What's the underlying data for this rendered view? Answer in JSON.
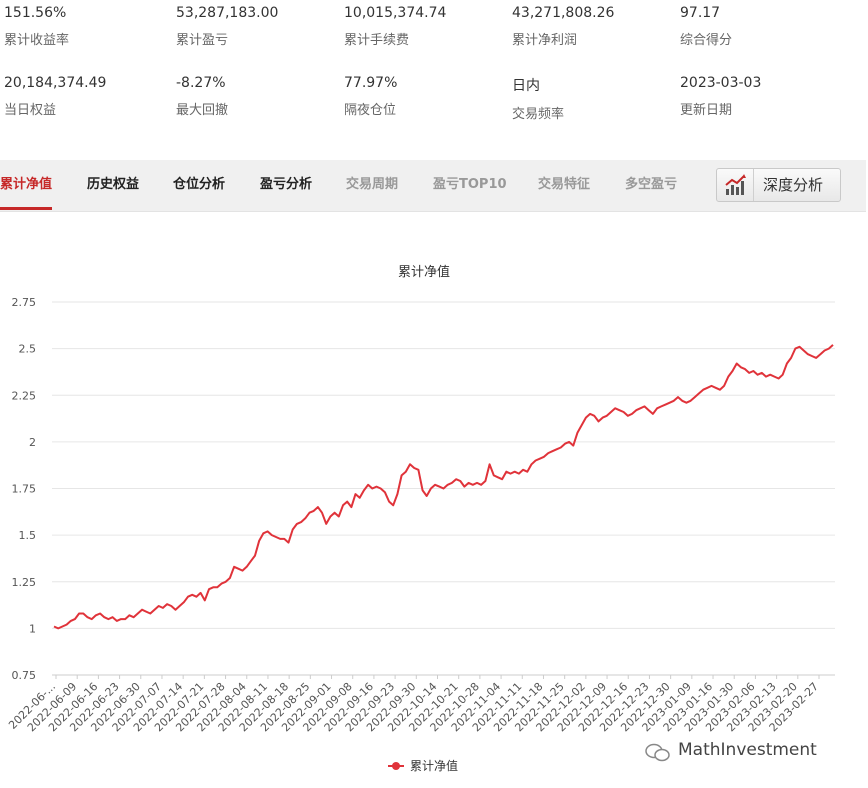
{
  "stats": [
    {
      "value": "151.56%",
      "label": "累计收益率"
    },
    {
      "value": "53,287,183.00",
      "label": "累计盈亏"
    },
    {
      "value": "10,015,374.74",
      "label": "累计手续费"
    },
    {
      "value": "43,271,808.26",
      "label": "累计净利润"
    },
    {
      "value": "97.17",
      "label": "综合得分"
    },
    {
      "value": "20,184,374.49",
      "label": "当日权益"
    },
    {
      "value": "-8.27%",
      "label": "最大回撤"
    },
    {
      "value": "77.97%",
      "label": "隔夜仓位"
    },
    {
      "value": "日内",
      "label": "交易频率"
    },
    {
      "value": "2023-03-03",
      "label": "更新日期"
    }
  ],
  "tabs": [
    {
      "label": "累计净值",
      "state": "active"
    },
    {
      "label": "历史权益",
      "state": "normal"
    },
    {
      "label": "仓位分析",
      "state": "normal"
    },
    {
      "label": "盈亏分析",
      "state": "normal"
    },
    {
      "label": "交易周期",
      "state": "dim"
    },
    {
      "label": "盈亏TOP10",
      "state": "dim"
    },
    {
      "label": "交易特征",
      "state": "dim"
    },
    {
      "label": "多空盈亏",
      "state": "dim"
    }
  ],
  "deep_button": {
    "label": "深度分析",
    "icon": "trend-chart-icon"
  },
  "watermark": {
    "text": "MathInvestment",
    "icon": "wechat-icon"
  },
  "colors": {
    "accent": "#c62828",
    "line": "#e0333a"
  },
  "chart_data": {
    "type": "line",
    "title": "累计净值",
    "ylim": [
      0.75,
      2.75
    ],
    "yticks": [
      "0.75",
      "1",
      "1.25",
      "1.5",
      "1.75",
      "2",
      "2.25",
      "2.5",
      "2.75"
    ],
    "xticks": [
      "2022-06-...",
      "2022-06-09",
      "2022-06-16",
      "2022-06-23",
      "2022-06-30",
      "2022-07-07",
      "2022-07-14",
      "2022-07-21",
      "2022-07-28",
      "2022-08-04",
      "2022-08-11",
      "2022-08-18",
      "2022-08-25",
      "2022-09-01",
      "2022-09-08",
      "2022-09-16",
      "2022-09-23",
      "2022-09-30",
      "2022-10-14",
      "2022-10-21",
      "2022-10-28",
      "2022-11-04",
      "2022-11-11",
      "2022-11-18",
      "2022-11-25",
      "2022-12-02",
      "2022-12-09",
      "2022-12-16",
      "2022-12-23",
      "2022-12-30",
      "2023-01-09",
      "2023-01-16",
      "2023-01-30",
      "2023-02-06",
      "2023-02-13",
      "2023-02-20",
      "2023-02-27"
    ],
    "grid": true,
    "legend_position": "bottom",
    "series": [
      {
        "name": "累计净值",
        "values": [
          1.01,
          1.0,
          1.01,
          1.02,
          1.04,
          1.05,
          1.08,
          1.08,
          1.06,
          1.05,
          1.07,
          1.08,
          1.06,
          1.05,
          1.06,
          1.04,
          1.05,
          1.05,
          1.07,
          1.06,
          1.08,
          1.1,
          1.09,
          1.08,
          1.1,
          1.12,
          1.11,
          1.13,
          1.12,
          1.1,
          1.12,
          1.14,
          1.17,
          1.18,
          1.17,
          1.19,
          1.15,
          1.21,
          1.22,
          1.22,
          1.24,
          1.25,
          1.27,
          1.33,
          1.32,
          1.31,
          1.33,
          1.36,
          1.39,
          1.47,
          1.51,
          1.52,
          1.5,
          1.49,
          1.48,
          1.48,
          1.46,
          1.53,
          1.56,
          1.57,
          1.59,
          1.62,
          1.63,
          1.65,
          1.62,
          1.56,
          1.6,
          1.62,
          1.6,
          1.66,
          1.68,
          1.65,
          1.72,
          1.7,
          1.74,
          1.77,
          1.75,
          1.76,
          1.75,
          1.73,
          1.68,
          1.66,
          1.72,
          1.82,
          1.84,
          1.88,
          1.86,
          1.85,
          1.74,
          1.71,
          1.75,
          1.77,
          1.76,
          1.75,
          1.77,
          1.78,
          1.8,
          1.79,
          1.76,
          1.78,
          1.77,
          1.78,
          1.77,
          1.79,
          1.88,
          1.82,
          1.81,
          1.8,
          1.84,
          1.83,
          1.84,
          1.83,
          1.85,
          1.84,
          1.88,
          1.9,
          1.91,
          1.92,
          1.94,
          1.95,
          1.96,
          1.97,
          1.99,
          2.0,
          1.98,
          2.05,
          2.09,
          2.13,
          2.15,
          2.14,
          2.11,
          2.13,
          2.14,
          2.16,
          2.18,
          2.17,
          2.16,
          2.14,
          2.15,
          2.17,
          2.18,
          2.19,
          2.17,
          2.15,
          2.18,
          2.19,
          2.2,
          2.21,
          2.22,
          2.24,
          2.22,
          2.21,
          2.22,
          2.24,
          2.26,
          2.28,
          2.29,
          2.3,
          2.29,
          2.28,
          2.3,
          2.35,
          2.38,
          2.42,
          2.4,
          2.39,
          2.37,
          2.38,
          2.36,
          2.37,
          2.35,
          2.36,
          2.35,
          2.34,
          2.36,
          2.42,
          2.45,
          2.5,
          2.51,
          2.49,
          2.47,
          2.46,
          2.45,
          2.47,
          2.49,
          2.5,
          2.52
        ]
      }
    ]
  }
}
